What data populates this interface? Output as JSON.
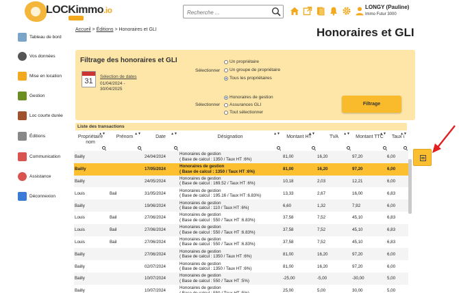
{
  "header": {
    "logo_text": "LOCKimmo",
    "logo_suffix": ".io",
    "search_placeholder": "Recherche ...",
    "user_name": "LONGY (Pauline)",
    "user_org": "Immo Futur 3000"
  },
  "sidebar": {
    "items": [
      {
        "label": "Tableau de bord",
        "icon": "dashboard-icon",
        "color": "#7aa4c8"
      },
      {
        "label": "Vos données",
        "icon": "person-icon",
        "color": "#555555"
      },
      {
        "label": "Mise en location",
        "icon": "key-location-icon",
        "color": "#f2a91e"
      },
      {
        "label": "Gestion",
        "icon": "gestion-icon",
        "color": "#6b8e23"
      },
      {
        "label": "Loc courte durée",
        "icon": "suitcase-icon",
        "color": "#a0522d"
      },
      {
        "label": "Éditions",
        "icon": "editions-icon",
        "color": "#888888"
      },
      {
        "label": "Communication",
        "icon": "communication-icon",
        "color": "#d9534f"
      },
      {
        "label": "Assistance",
        "icon": "assistance-icon",
        "color": "#d9534f"
      },
      {
        "label": "Déconnexion",
        "icon": "logout-icon",
        "color": "#3b7bd8"
      }
    ]
  },
  "breadcrumb": {
    "home": "Accueil",
    "sep": ">",
    "section": "Éditions",
    "current": "Honoraires et GLI"
  },
  "page_title": "Honoraires et GLI",
  "filter": {
    "title": "Filtrage des honoraires et GLI",
    "calendar_day": "31",
    "date_link": "Sélection de dates",
    "date_range_line1": "01/04/2024 -",
    "date_range_line2": "30/04/2025",
    "select_label_1": "Sélectionner",
    "owners": [
      {
        "label": "Un propriétaire",
        "checked": false
      },
      {
        "label": "Un groupe de propriétaire",
        "checked": false
      },
      {
        "label": "Tous les propriétaires",
        "checked": true
      }
    ],
    "select_label_2": "Sélectionner",
    "types": [
      {
        "label": "Honoraires de gestion",
        "checked": true
      },
      {
        "label": "Assurances GLI",
        "checked": false
      },
      {
        "label": "Tout sélectionner",
        "checked": false
      }
    ],
    "button": "Filtrage"
  },
  "table": {
    "title": "Liste des transactions",
    "columns": [
      "Propriétaire nom",
      "Prénom",
      "Date",
      "Désignation",
      "Montant HT",
      "TVA",
      "Montant TTC",
      "Taux i"
    ],
    "rows": [
      {
        "nom": "Bailly",
        "prenom": "",
        "date": "24/04/2024",
        "d1": "Honoraires de gestion",
        "d2": "( Base de calcul : 1350 / Taux HT :6%)",
        "ht": "81,00",
        "tva": "16,20",
        "ttc": "97,20",
        "taux": "6,00"
      },
      {
        "nom": "Bailly",
        "prenom": "",
        "date": "17/05/2024",
        "d1": "Honoraires de gestion",
        "d2": "( Base de calcul : 1350 / Taux HT :6%)",
        "ht": "81,00",
        "tva": "16,20",
        "ttc": "97,20",
        "taux": "6,00"
      },
      {
        "nom": "Bailly",
        "prenom": "",
        "date": "24/05/2024",
        "d1": "Honoraires de gestion",
        "d2": "( Base de calcul : 169.52 / Taux HT :6%)",
        "ht": "10,18",
        "tva": "2,03",
        "ttc": "12,21",
        "taux": "6,00"
      },
      {
        "nom": "Louis",
        "prenom": "Bail",
        "date": "31/05/2024",
        "d1": "Honoraires de gestion",
        "d2": "( Base de calcul : 195.16 / Taux HT :6.83%)",
        "ht": "13,33",
        "tva": "2,67",
        "ttc": "16,00",
        "taux": "6,83"
      },
      {
        "nom": "Bailly",
        "prenom": "",
        "date": "19/06/2024",
        "d1": "Honoraires de gestion",
        "d2": "( Base de calcul : 110 / Taux HT :6%)",
        "ht": "6,60",
        "tva": "1,32",
        "ttc": "7,92",
        "taux": "6,00"
      },
      {
        "nom": "Louis",
        "prenom": "Bail",
        "date": "27/06/2024",
        "d1": "Honoraires de gestion",
        "d2": "( Base de calcul : 550 / Taux HT :6.83%)",
        "ht": "37,58",
        "tva": "7,52",
        "ttc": "45,10",
        "taux": "6,83"
      },
      {
        "nom": "Louis",
        "prenom": "Bail",
        "date": "27/06/2024",
        "d1": "Honoraires de gestion",
        "d2": "( Base de calcul : 550 / Taux HT :6.83%)",
        "ht": "37,58",
        "tva": "7,52",
        "ttc": "45,10",
        "taux": "6,83"
      },
      {
        "nom": "Louis",
        "prenom": "Bail",
        "date": "27/06/2024",
        "d1": "Honoraires de gestion",
        "d2": "( Base de calcul : 550 / Taux HT :6.83%)",
        "ht": "37,58",
        "tva": "7,52",
        "ttc": "45,10",
        "taux": "6,83"
      },
      {
        "nom": "Bailly",
        "prenom": "",
        "date": "27/06/2024",
        "d1": "Honoraires de gestion",
        "d2": "( Base de calcul : 1350 / Taux HT :6%)",
        "ht": "81,00",
        "tva": "16,20",
        "ttc": "97,20",
        "taux": "6,00"
      },
      {
        "nom": "Bailly",
        "prenom": "",
        "date": "02/07/2024",
        "d1": "Honoraires de gestion",
        "d2": "( Base de calcul : 1350 / Taux HT :6%)",
        "ht": "81,00",
        "tva": "16,20",
        "ttc": "97,20",
        "taux": "6,00"
      },
      {
        "nom": "Bailly",
        "prenom": "",
        "date": "10/07/2024",
        "d1": "Honoraires de gestion",
        "d2": "( Base de calcul : 550 / Taux HT :5%)",
        "ht": "-25,00",
        "tva": "-5,00",
        "ttc": "-30,00",
        "taux": "5,00"
      },
      {
        "nom": "Bailly",
        "prenom": "",
        "date": "10/07/2024",
        "d1": "Honoraires de gestion",
        "d2": "( Base de calcul : 550 / Taux HT :5%)",
        "ht": "25,00",
        "tva": "5,00",
        "ttc": "30,00",
        "taux": "5,00"
      }
    ],
    "highlighted_row": 1
  },
  "colors": {
    "accent": "#fbbf30",
    "panel": "#fde6a8",
    "annotation": "#e02020"
  }
}
